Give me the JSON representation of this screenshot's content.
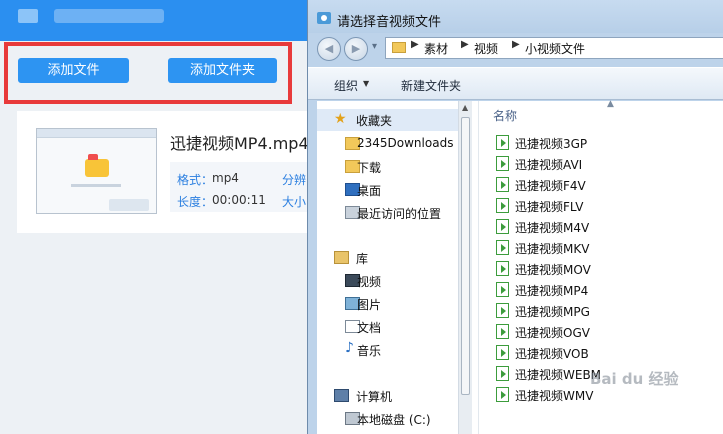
{
  "app": {
    "buttons": {
      "add_file": "添加文件",
      "add_folder": "添加文件夹"
    },
    "video": {
      "filename": "迅捷视频MP4.mp4",
      "format_label": "格式：",
      "format_value": "mp4",
      "resolution_label": "分辨",
      "duration_label": "长度：",
      "duration_value": "00:00:11",
      "size_label": "大小"
    }
  },
  "dialog": {
    "title": "请选择音视频文件",
    "breadcrumbs": [
      "素材",
      "视频",
      "小视频文件"
    ],
    "toolbar": {
      "organize": "组织",
      "new_folder": "新建文件夹"
    },
    "nav": {
      "favorites": "收藏夹",
      "favorites_items": [
        "2345Downloads",
        "下载",
        "桌面",
        "最近访问的位置"
      ],
      "libraries": "库",
      "library_items": [
        "视频",
        "图片",
        "文档",
        "音乐"
      ],
      "computer": "计算机",
      "computer_items": [
        "本地磁盘 (C:)"
      ]
    },
    "file_list": {
      "column_name": "名称",
      "files": [
        "迅捷视频3GP",
        "迅捷视频AVI",
        "迅捷视频F4V",
        "迅捷视频FLV",
        "迅捷视频M4V",
        "迅捷视频MKV",
        "迅捷视频MOV",
        "迅捷视频MP4",
        "迅捷视频MPG",
        "迅捷视频OGV",
        "迅捷视频VOB",
        "迅捷视频WEBM",
        "迅捷视频WMV"
      ]
    }
  },
  "watermark": "Bai du 经验",
  "colors": {
    "app_header": "#2b8ff0",
    "highlight": "#e83a3a",
    "button": "#2d94f2"
  }
}
